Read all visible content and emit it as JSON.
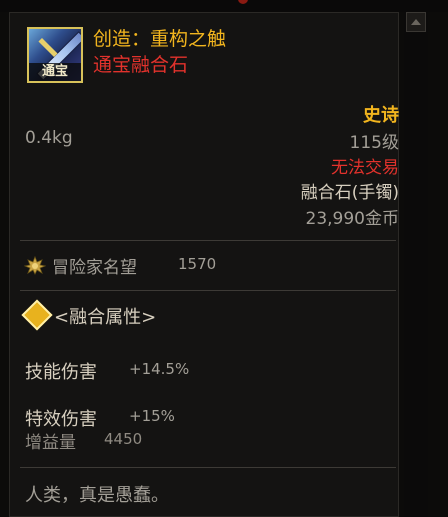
{
  "item": {
    "icon_badge": "通宝",
    "name": "创造：重构之触",
    "type": "通宝融合石",
    "rarity": "史诗",
    "level": "115级",
    "trade_status": "无法交易",
    "slot": "融合石(手镯)",
    "price": "23,990金币",
    "weight": "0.4kg"
  },
  "fame": {
    "label": "冒险家名望",
    "value": "1570"
  },
  "fusion": {
    "label": "<融合属性>"
  },
  "stats": [
    {
      "label": "技能伤害",
      "value": "+14.5%"
    },
    {
      "label": "特效伤害",
      "value": "+15%"
    }
  ],
  "buff": {
    "label": "增益量",
    "value": "4450"
  },
  "flavor": "人类，真是愚蠢。",
  "colors": {
    "epic_gold": "#f2b51e",
    "red": "#e2322c",
    "gray": "#a39f97",
    "light": "#d7cfbf",
    "panel_bg": "#141312"
  },
  "icons": {
    "item": "sword-item-icon",
    "fame": "fame-crest-icon",
    "fusion": "fusion-diamond-icon",
    "scroll_up": "scroll-up-arrow-icon"
  }
}
